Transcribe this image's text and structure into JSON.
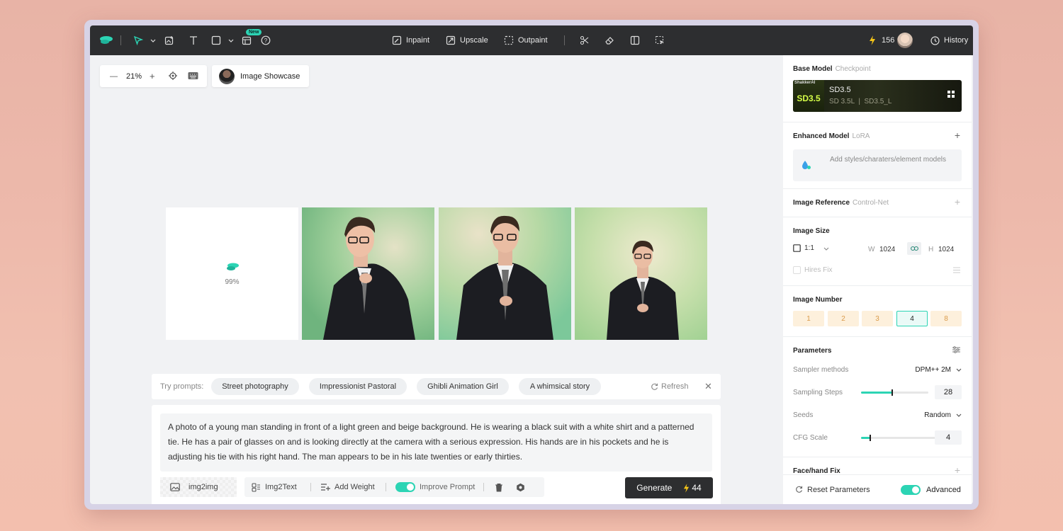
{
  "toolbar": {
    "new_badge": "New",
    "inpaint_label": "Inpaint",
    "upscale_label": "Upscale",
    "outpaint_label": "Outpaint",
    "credits": "156",
    "history_label": "History"
  },
  "canvas": {
    "zoom_value": "21%",
    "showcase_label": "Image Showcase",
    "progress_percent": "99%"
  },
  "prompts": {
    "try_label": "Try prompts:",
    "chips": [
      "Street photography",
      "Impressionist Pastoral",
      "Ghibli Animation Girl",
      "A whimsical story"
    ],
    "refresh_label": "Refresh",
    "prompt_text": "A photo of a young man standing in front of a light green and beige background. He is wearing a black suit with a white shirt and a patterned tie. He has a pair of glasses on and is looking directly at the camera with a serious expression. His hands are in his pockets and he is adjusting his tie with his right hand. The man appears to be in his late twenties or early thirties.",
    "img2img_label": "img2img",
    "img2text_label": "Img2Text",
    "add_weight_label": "Add Weight",
    "improve_prompt_label": "Improve Prompt",
    "improve_prompt_on": true,
    "generate_label": "Generate",
    "generate_cost": "44"
  },
  "panel": {
    "base_model_title": "Base Model",
    "base_model_sub": "Checkpoint",
    "model_thumb_text": "SD3.5",
    "model_brand": "ShakkerAI",
    "model_name": "SD3.5",
    "model_tags": "SD 3.5L  |  SD3.5_L",
    "enhanced_title": "Enhanced Model",
    "enhanced_sub": "LoRA",
    "lora_placeholder": "Add styles/charaters/element models",
    "image_ref_title": "Image Reference",
    "image_ref_sub": "Control-Net",
    "image_size_title": "Image Size",
    "ratio": "1:1",
    "width_label": "W",
    "width_value": "1024",
    "height_label": "H",
    "height_value": "1024",
    "hires_label": "Hires Fix",
    "image_number_title": "Image Number",
    "image_numbers": [
      "1",
      "2",
      "3",
      "4",
      "8"
    ],
    "selected_number": "4",
    "parameters_title": "Parameters",
    "sampler_label": "Sampler methods",
    "sampler_value": "DPM++ 2M",
    "steps_label": "Sampling Steps",
    "steps_value": "28",
    "seeds_label": "Seeds",
    "seeds_value": "Random",
    "cfg_label": "CFG Scale",
    "cfg_value": "4",
    "face_fix_title": "Face/hand Fix",
    "reset_label": "Reset Parameters",
    "advanced_label": "Advanced",
    "advanced_on": true
  },
  "colors": {
    "accent": "#2cd4b4",
    "toolbar_bg": "#2d2e30",
    "credit_bolt": "#f5c518"
  }
}
